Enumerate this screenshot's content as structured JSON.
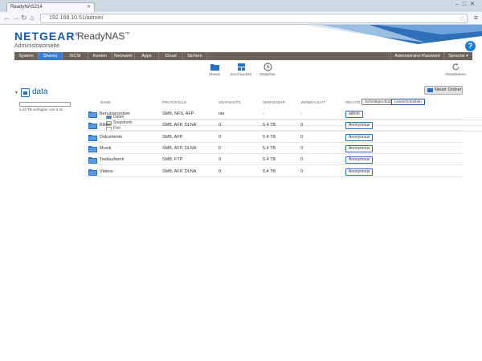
{
  "browser": {
    "tab_title": "ReadyNAS214",
    "url": "192.168.10.51/admin/"
  },
  "header": {
    "logo": "NETGEAR",
    "product": "ReadyNAS",
    "trademark": "™",
    "subtitle": "Administratorseite",
    "help": "?"
  },
  "nav": {
    "items": [
      "System",
      "Shares",
      "iSCSI",
      "Konten",
      "Netzwerk",
      "Apps",
      "Cloud",
      "Sichern"
    ],
    "active": "Shares",
    "admin_password": "Administrator-Passwort",
    "language": "Sprache ▾"
  },
  "toolbar": {
    "shares": "Shares",
    "browse": "Durchsuchen",
    "timeline": "Zeitachse",
    "refresh": "Aktualisieren"
  },
  "volume": {
    "name": "data",
    "usage_fraction": 0.0,
    "available_text": "5.44 TB verfügbar von 5.44...",
    "legend": [
      {
        "label": "Daten",
        "color": "#2d7fd9"
      },
      {
        "label": "Snapshots",
        "color": "#f6e7a8"
      },
      {
        "label": "Frei",
        "color": "#ffffff"
      }
    ]
  },
  "shares_panel": {
    "new_folder": "Neuer Ordner",
    "columns": {
      "name": "Name",
      "protocols": "Protokolle",
      "snapshots": "Snapshots",
      "available": "Verfügbar",
      "used": "Verbraucht",
      "rights": "Rechte"
    },
    "permission_modes": [
      "Schreibgeschützt",
      "Lesen/Schreiben"
    ],
    "rows": [
      {
        "name": "Benutzerordner",
        "protocols": "SMB, NFS, AFP",
        "snapshots": "nie",
        "available": "-",
        "used": "-",
        "rights": "admin"
      },
      {
        "name": "Bilder",
        "protocols": "SMB, AFP, DLNA",
        "snapshots": "0",
        "available": "5.4 TB",
        "used": "0",
        "rights": "Anonymous"
      },
      {
        "name": "Dokumente",
        "protocols": "SMB, AFP",
        "snapshots": "0",
        "available": "5.4 TB",
        "used": "0",
        "rights": "Anonymous"
      },
      {
        "name": "Musik",
        "protocols": "SMB, AFP, DLNA",
        "snapshots": "0",
        "available": "5.4 TB",
        "used": "0",
        "rights": "Anonymous"
      },
      {
        "name": "Testlaufwerk",
        "protocols": "SMB, FTP",
        "snapshots": "0",
        "available": "5.4 TB",
        "used": "0",
        "rights": "Anonymous"
      },
      {
        "name": "Videos",
        "protocols": "SMB, AFP, DLNA",
        "snapshots": "0",
        "available": "5.4 TB",
        "used": "0",
        "rights": "Anonymous"
      }
    ]
  },
  "colors": {
    "accent": "#1b5aa6",
    "nav_bg": "#6b6359",
    "nav_active": "#3a7fcf"
  }
}
